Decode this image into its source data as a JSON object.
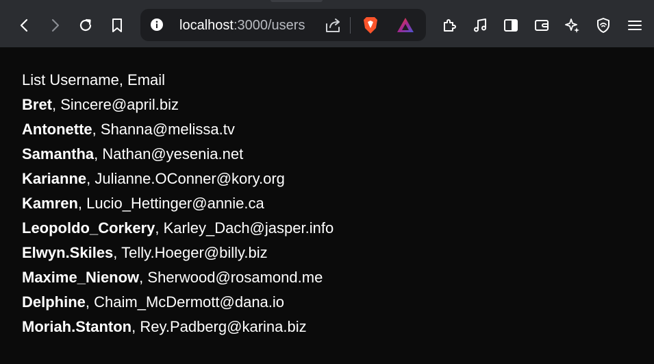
{
  "browser": {
    "url_host": "localhost",
    "url_rest": ":3000/users",
    "icons": [
      "back-icon",
      "forward-icon",
      "reload-icon",
      "bookmark-icon",
      "site-info-icon",
      "share-icon",
      "brave-shields-icon",
      "brave-rewards-icon",
      "extensions-icon",
      "media-icon",
      "sidebar-icon",
      "wallet-icon",
      "leo-ai-icon",
      "vpn-icon",
      "menu-icon"
    ],
    "colors": {
      "toolbar": "#2b2d31",
      "address_bar": "#1c1d20",
      "page_bg": "#0b0b0b",
      "brave_orange": "#fb542b"
    }
  },
  "page": {
    "heading": "List Username, Email",
    "users": [
      {
        "username": "Bret",
        "email": "Sincere@april.biz"
      },
      {
        "username": "Antonette",
        "email": "Shanna@melissa.tv"
      },
      {
        "username": "Samantha",
        "email": "Nathan@yesenia.net"
      },
      {
        "username": "Karianne",
        "email": "Julianne.OConner@kory.org"
      },
      {
        "username": "Kamren",
        "email": "Lucio_Hettinger@annie.ca"
      },
      {
        "username": "Leopoldo_Corkery",
        "email": "Karley_Dach@jasper.info"
      },
      {
        "username": "Elwyn.Skiles",
        "email": "Telly.Hoeger@billy.biz"
      },
      {
        "username": "Maxime_Nienow",
        "email": "Sherwood@rosamond.me"
      },
      {
        "username": "Delphine",
        "email": "Chaim_McDermott@dana.io"
      },
      {
        "username": "Moriah.Stanton",
        "email": "Rey.Padberg@karina.biz"
      }
    ],
    "separator": ", "
  }
}
